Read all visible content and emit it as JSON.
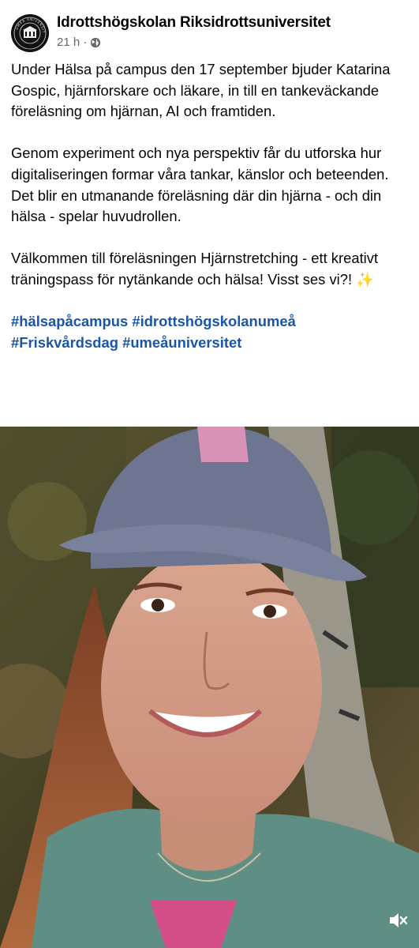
{
  "post": {
    "page_name": "Idrottshögskolan Riksidrottsuniversitet",
    "time": "21 h",
    "separator": "·",
    "audience_icon": "globe-icon",
    "paragraphs": [
      "Under Hälsa på campus den 17 september bjuder Katarina Gospic, hjärnforskare och läkare, in till en tankeväckande föreläsning om hjärnan, AI och framtiden.",
      "Genom experiment och nya perspektiv får du utforska hur digitaliseringen formar våra tankar, känslor och beteenden. Det blir en utmanande föreläsning där din hjärna - och din hälsa - spelar huvudrollen.",
      "Välkommen till föreläsningen Hjärnstretching - ett kreativt träningspass för nytänkande och hälsa! Visst ses vi?! ✨"
    ],
    "hashtags": [
      "#hälsapåcampus",
      "#idrottshögskolanumeå",
      "#Friskvårdsdag",
      "#umeåuniversitet"
    ],
    "avatar_text": "UMEÅ UNIVERSITET"
  },
  "video": {
    "mute_icon": "speaker-muted-icon"
  },
  "colors": {
    "text": "#050505",
    "meta": "#65676b",
    "hashtag": "#1a56a6"
  }
}
